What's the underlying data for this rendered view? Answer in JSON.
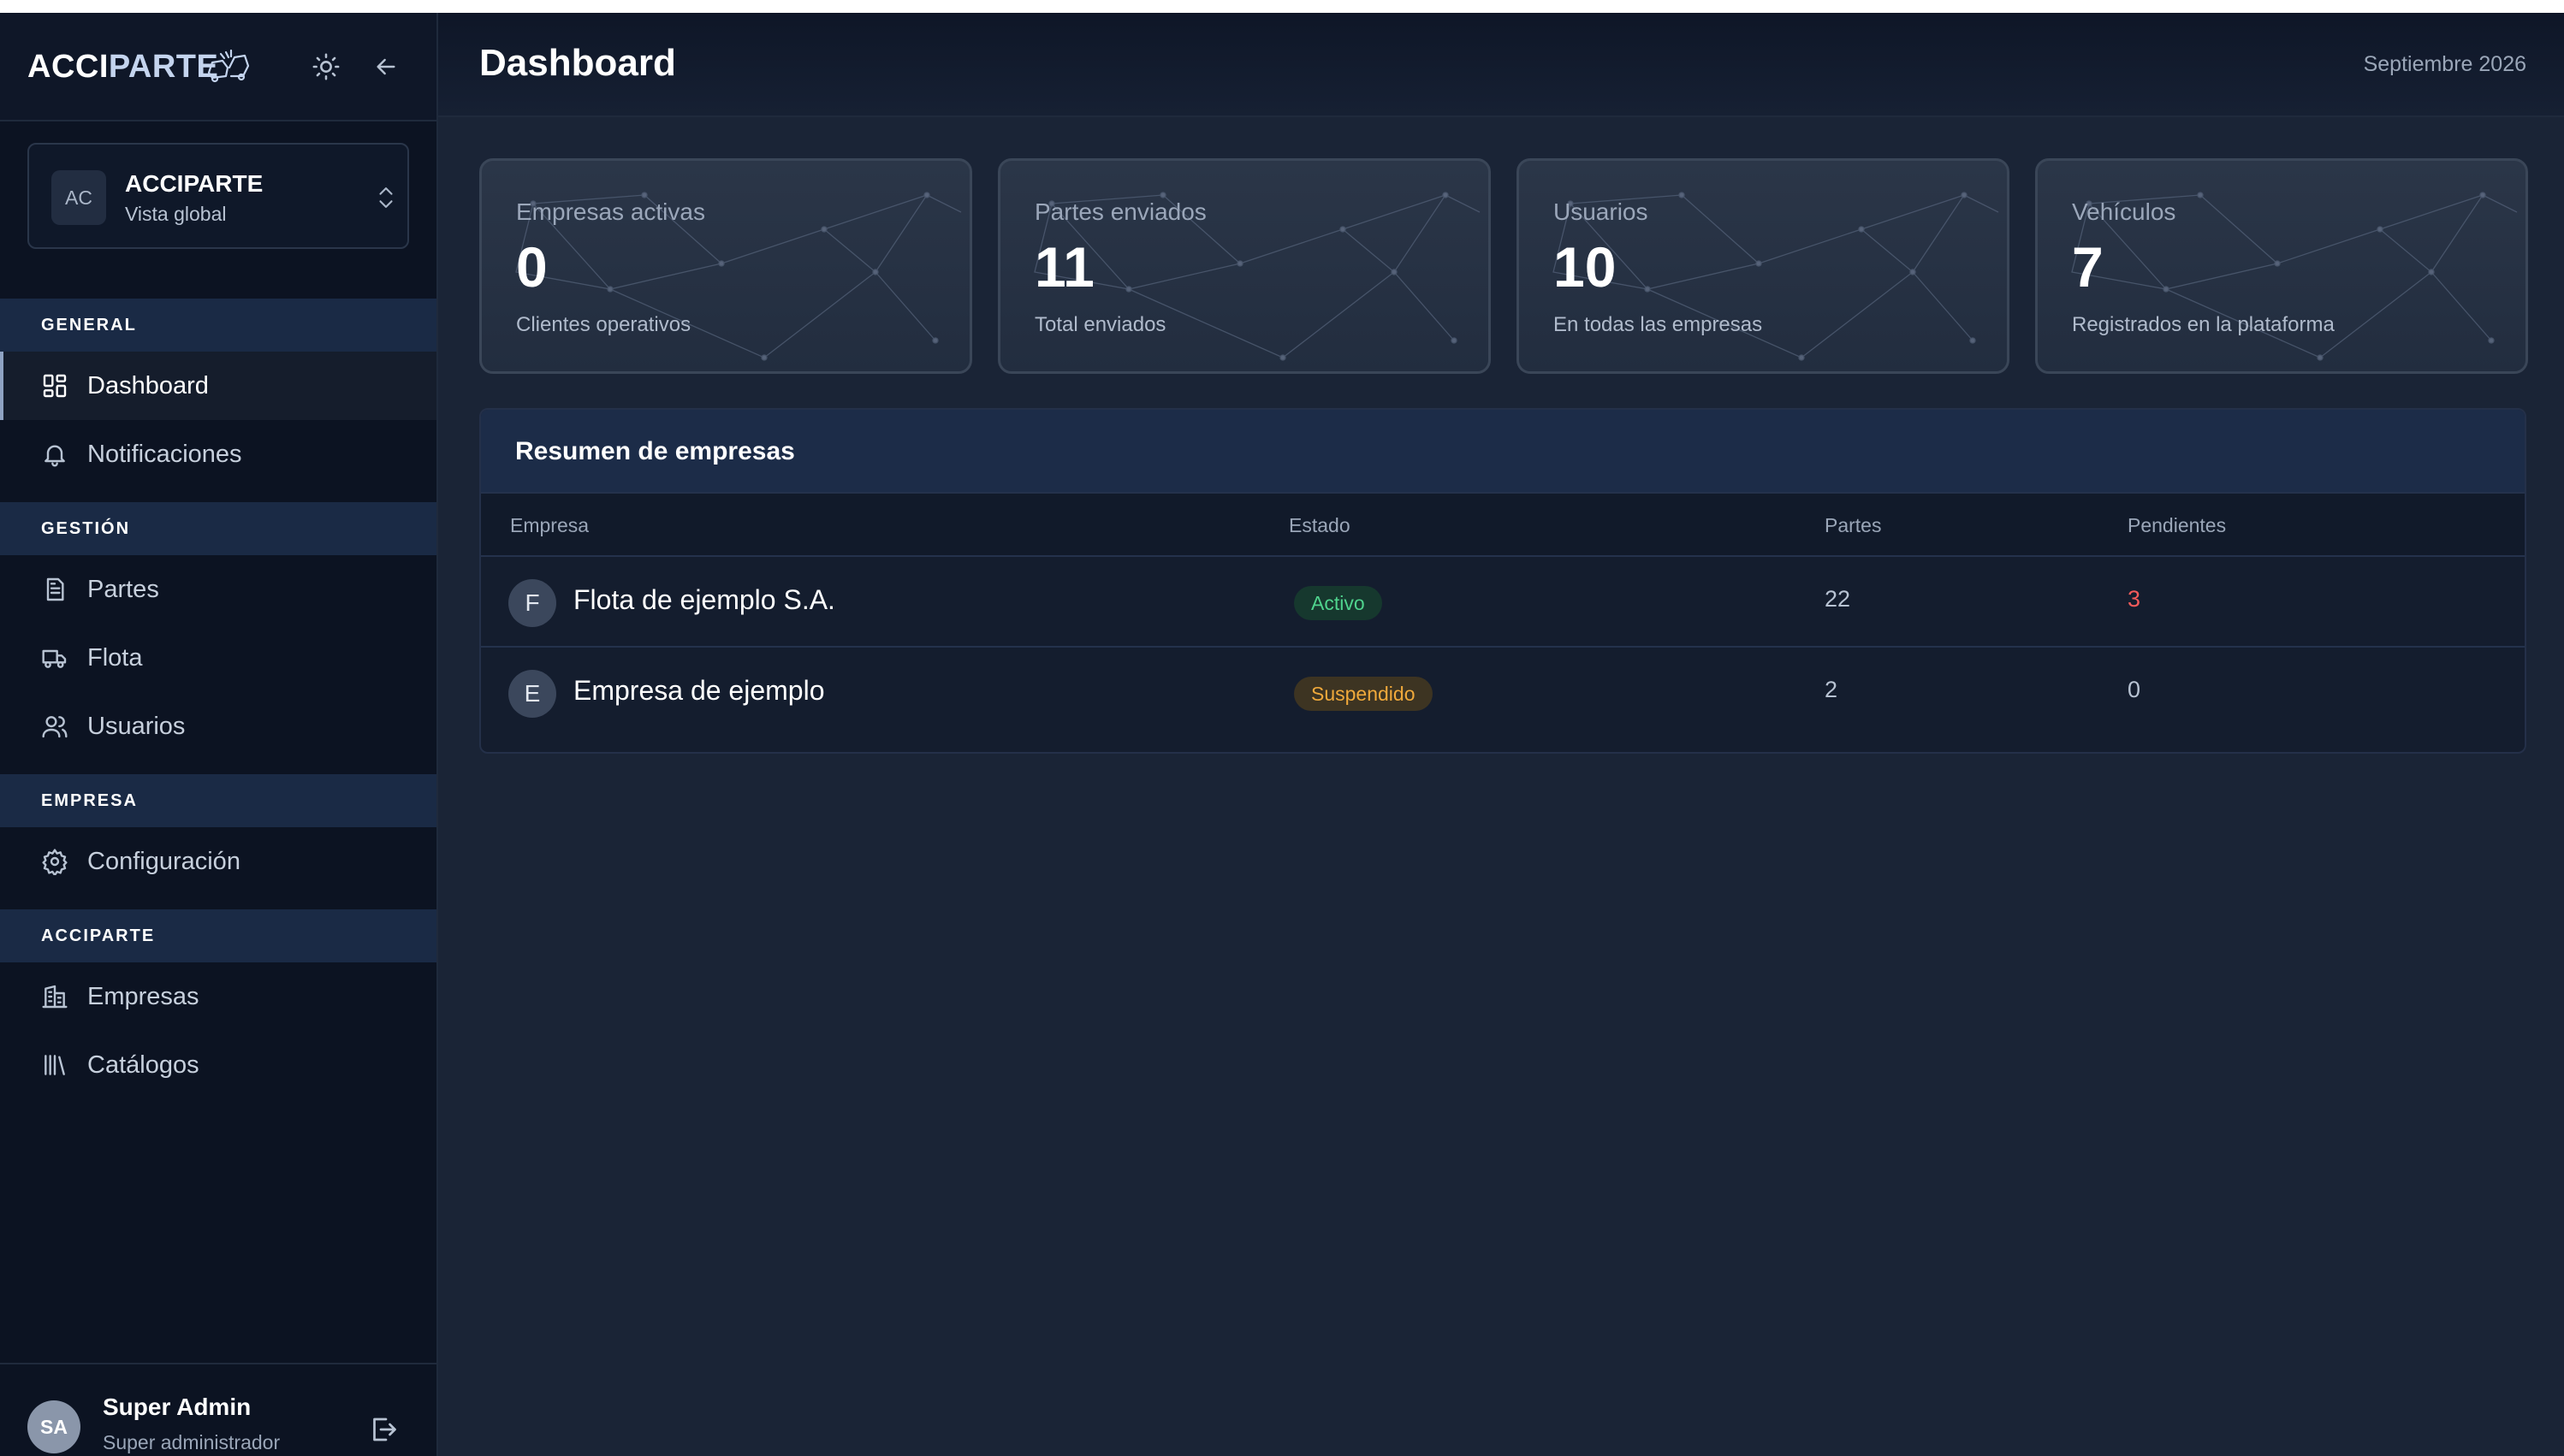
{
  "sidebar": {
    "logo_main": "ACCI",
    "logo_accent": "PARTE",
    "workspace": {
      "initials": "AC",
      "name": "ACCIPARTE",
      "subtitle": "Vista global"
    },
    "sections": [
      {
        "label": "GENERAL",
        "items": [
          {
            "label": "Dashboard",
            "icon": "dashboard-icon",
            "active": true
          },
          {
            "label": "Notificaciones",
            "icon": "bell-icon"
          }
        ]
      },
      {
        "label": "GESTIÓN",
        "items": [
          {
            "label": "Partes",
            "icon": "document-icon"
          },
          {
            "label": "Flota",
            "icon": "truck-icon"
          },
          {
            "label": "Usuarios",
            "icon": "users-icon"
          }
        ]
      },
      {
        "label": "EMPRESA",
        "items": [
          {
            "label": "Configuración",
            "icon": "gear-icon"
          }
        ]
      },
      {
        "label": "ACCIPARTE",
        "items": [
          {
            "label": "Empresas",
            "icon": "building-icon"
          },
          {
            "label": "Catálogos",
            "icon": "library-icon"
          }
        ]
      }
    ],
    "user": {
      "initials": "SA",
      "name": "Super Admin",
      "role": "Super administrador"
    }
  },
  "header": {
    "title": "Dashboard",
    "date": "Septiembre 2026"
  },
  "stats": [
    {
      "label": "Empresas activas",
      "value": "0",
      "sub": "Clientes operativos"
    },
    {
      "label": "Partes enviados",
      "value": "11",
      "sub": "Total enviados"
    },
    {
      "label": "Usuarios",
      "value": "10",
      "sub": "En todas las empresas"
    },
    {
      "label": "Vehículos",
      "value": "7",
      "sub": "Registrados en la plataforma"
    }
  ],
  "summary": {
    "title": "Resumen de empresas",
    "columns": [
      "Empresa",
      "Estado",
      "Partes",
      "Pendientes"
    ],
    "rows": [
      {
        "initial": "F",
        "name": "Flota de ejemplo S.A.",
        "status": "Activo",
        "partes": "22",
        "pendientes": "3"
      },
      {
        "initial": "E",
        "name": "Empresa de ejemplo",
        "status": "Suspendido",
        "partes": "2",
        "pendientes": "0"
      }
    ]
  },
  "colors": {
    "accent": "#1a2a45",
    "active_badge": "#4fd38d",
    "suspended_badge": "#f0a93b",
    "pending_alert": "#f45b5b"
  }
}
